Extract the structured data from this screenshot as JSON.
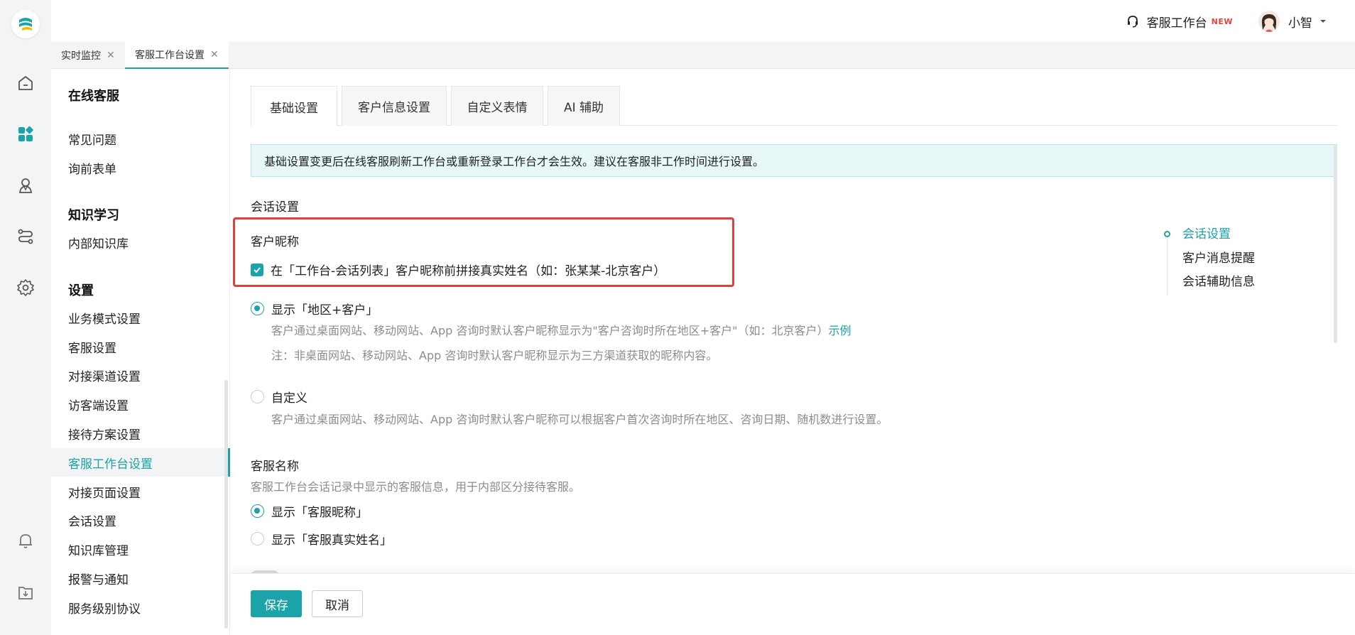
{
  "topbar": {
    "workbench_label": "客服工作台",
    "new_badge": "NEW",
    "username": "小智"
  },
  "page_tabs": [
    {
      "label": "实时监控"
    },
    {
      "label": "客服工作台设置"
    }
  ],
  "menu": {
    "groups": [
      {
        "title": "在线客服",
        "items": [
          "常见问题",
          "询前表单"
        ]
      },
      {
        "title": "知识学习",
        "items": [
          "内部知识库"
        ]
      },
      {
        "title": "设置",
        "items": [
          "业务模式设置",
          "客服设置",
          "对接渠道设置",
          "访客端设置",
          "接待方案设置",
          "客服工作台设置",
          "对接页面设置",
          "会话设置",
          "知识库管理",
          "报警与通知",
          "服务级别协议"
        ]
      }
    ],
    "active_item": "客服工作台设置"
  },
  "inner_tabs": [
    "基础设置",
    "客户信息设置",
    "自定义表情",
    "AI 辅助"
  ],
  "notice": "基础设置变更后在线客服刷新工作台或重新登录工作台才会生效。建议在客服非工作时间进行设置。",
  "session": {
    "title": "会话设置",
    "nickname_title": "客户昵称",
    "append_real_name_label": "在「工作台-会话列表」客户昵称前拼接真实姓名（如：张某某-北京客户）",
    "append_real_name_checked": true,
    "option_region": {
      "label": "显示「地区+客户」",
      "selected": true,
      "desc1": "客户通过桌面网站、移动网站、App 咨询时默认客户昵称显示为\"客户咨询时所在地区+客户\"（如：北京客户）",
      "example_link": "示例",
      "desc2": "注：非桌面网站、移动网站、App 咨询时默认客户昵称显示为三方渠道获取的昵称内容。"
    },
    "option_custom": {
      "label": "自定义",
      "selected": false,
      "desc": "客户通过桌面网站、移动网站、App 咨询时默认客户昵称可以根据客户首次咨询时所在地区、咨询日期、随机数进行设置。"
    }
  },
  "agent_name": {
    "title": "客服名称",
    "desc": "客服工作台会话记录中显示的客服信息，用于内部区分接待客服。",
    "options": [
      {
        "label": "显示「客服昵称」",
        "selected": true
      },
      {
        "label": "显示「客服真实姓名」",
        "selected": false
      }
    ]
  },
  "anchor_nav": [
    "会话设置",
    "客户消息提醒",
    "会话辅助信息"
  ],
  "footer": {
    "save_label": "保存",
    "cancel_label": "取消"
  },
  "colors": {
    "accent": "#1aa3a8",
    "highlight_border": "#e0403a",
    "notice_bg": "#e8f8f8"
  }
}
